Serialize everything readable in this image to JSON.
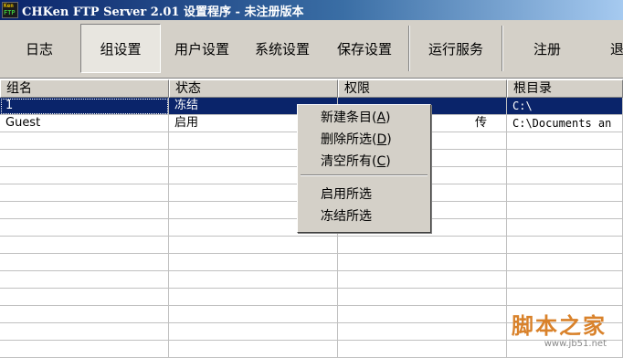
{
  "window": {
    "title": "CHKen FTP Server 2.01 设置程序 - 未注册版本",
    "icon": "chken-app-icon",
    "icon_text_top": "Ken",
    "icon_text_bottom": "FTP"
  },
  "toolbar": {
    "buttons": [
      {
        "label": "日志",
        "active": false
      },
      {
        "label": "组设置",
        "active": true
      },
      {
        "label": "用户设置",
        "active": false
      },
      {
        "label": "系统设置",
        "active": false
      },
      {
        "label": "保存设置",
        "active": false
      },
      {
        "label": "运行服务",
        "active": false
      },
      {
        "label": "注册",
        "active": false
      },
      {
        "label": "退",
        "active": false
      }
    ]
  },
  "table": {
    "columns": [
      "组名",
      "状态",
      "权限",
      "根目录"
    ],
    "rows": [
      {
        "name": "1",
        "status": "冻结",
        "perm": "",
        "root": "C:\\",
        "selected": true
      },
      {
        "name": "Guest",
        "status": "启用",
        "perm": "传",
        "root": "C:\\Documents an",
        "selected": false
      }
    ]
  },
  "context_menu": {
    "items": [
      {
        "label": "新建条目",
        "accel": "A"
      },
      {
        "label": "删除所选",
        "accel": "D"
      },
      {
        "label": "清空所有",
        "accel": "C"
      },
      {
        "label": "启用所选",
        "accel": ""
      },
      {
        "label": "冻结所选",
        "accel": ""
      }
    ]
  },
  "watermark": {
    "main": "脚本之家",
    "url": "www.jb51.net"
  },
  "colors": {
    "titlebar_start": "#0a246a",
    "titlebar_end": "#a6caf0",
    "face": "#d4d0c8",
    "selection": "#0a246a",
    "watermark": "#d9822b"
  }
}
